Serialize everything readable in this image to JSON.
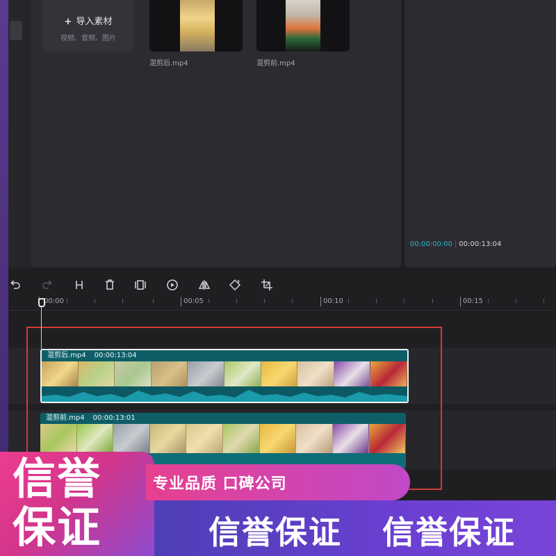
{
  "media_library": {
    "import_label": "导入素材",
    "import_hint": "视频、音频、图片",
    "items": [
      {
        "name": "混剪后.mp4"
      },
      {
        "name": "混剪前.mp4"
      }
    ]
  },
  "preview": {
    "current_time": "00:00:00:00",
    "total_time": "00:00:13:04"
  },
  "toolbar": {
    "tools": [
      "undo-icon",
      "redo-icon",
      "split-icon",
      "delete-icon",
      "freeze-icon",
      "speed-icon",
      "mirror-icon",
      "rotate-icon",
      "crop-icon"
    ]
  },
  "ruler": {
    "labels": [
      "00:00",
      "00:05",
      "00:10",
      "00:15"
    ]
  },
  "timeline": {
    "clips": [
      {
        "name": "混剪后.mp4",
        "duration": "00:00:13:04",
        "selected": true
      },
      {
        "name": "混剪前.mp4",
        "duration": "00:00:13:01",
        "selected": false
      }
    ]
  },
  "promo": {
    "badge": "信誉保证",
    "tagline": "专业品质 口碑公司",
    "banner_left": "信誉保证",
    "banner_right": "信誉保证"
  },
  "colors": {
    "accent_time": "#2fb4c6",
    "clip_teal": "#0f6d79",
    "selection_red": "#d23a3a",
    "promo_pink": "#ec3d8f",
    "promo_purple": "#6a3fd0"
  }
}
